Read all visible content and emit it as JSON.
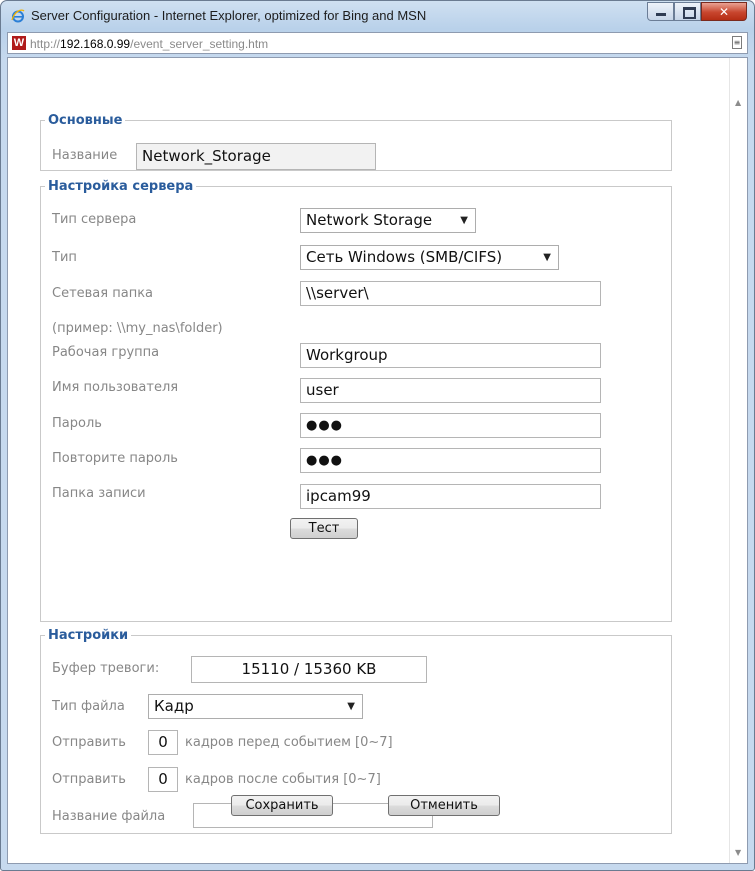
{
  "window": {
    "title": "Server Configuration - Internet Explorer, optimized for Bing and MSN",
    "url_prefix": "http://",
    "url_host": "192.168.0.99",
    "url_path": "/event_server_setting.htm",
    "site_icon_letter": "W"
  },
  "basic": {
    "legend": "Основные",
    "name_label": "Название",
    "name_value": "Network_Storage"
  },
  "server": {
    "legend": "Настройка сервера",
    "server_type_label": "Тип сервера",
    "server_type_value": "Network Storage",
    "type_label": "Тип",
    "type_value": "Сеть Windows (SMB/CIFS)",
    "share_label": "Сетевая папка",
    "share_value": "\\\\server\\",
    "share_example": "(пример: \\\\my_nas\\folder)",
    "workgroup_label": "Рабочая группа",
    "workgroup_value": "Workgroup",
    "user_label": "Имя пользователя",
    "user_value": "user",
    "password_label": "Пароль",
    "password_value": "●●●",
    "password_repeat_label": "Повторите пароль",
    "password_repeat_value": "●●●",
    "folder_label": "Папка записи",
    "folder_value": "ipcam99",
    "test_button": "Тест"
  },
  "settings": {
    "legend": "Настройки",
    "buffer_label": "Буфер тревоги:",
    "buffer_value": "15110 / 15360 KB",
    "file_type_label": "Тип файла",
    "file_type_value": "Кадр",
    "send_label_1": "Отправить",
    "frames_before_value": "0",
    "frames_before_text": "кадров перед событием [0~7]",
    "send_label_2": "Отправить",
    "frames_after_value": "0",
    "frames_after_text": "кадров после события [0~7]",
    "file_name_label": "Название файла",
    "file_name_value": ""
  },
  "actions": {
    "save_button": "Сохранить",
    "cancel_button": "Отменить"
  }
}
